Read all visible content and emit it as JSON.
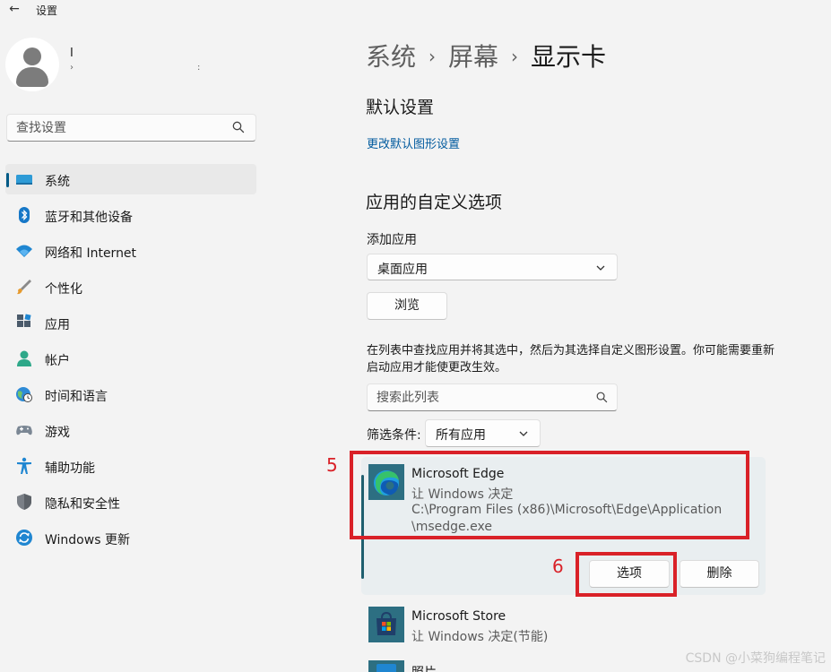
{
  "window": {
    "title": "设置",
    "back_icon": "back-arrow-icon"
  },
  "user": {
    "name": "I",
    "email": "›",
    "email_tail": ":"
  },
  "sidebar": {
    "search_placeholder": "查找设置",
    "items": [
      {
        "label": "系统",
        "icon": "monitor-icon",
        "active": true
      },
      {
        "label": "蓝牙和其他设备",
        "icon": "bluetooth-icon"
      },
      {
        "label": "网络和 Internet",
        "icon": "wifi-icon"
      },
      {
        "label": "个性化",
        "icon": "brush-icon"
      },
      {
        "label": "应用",
        "icon": "apps-icon"
      },
      {
        "label": "帐户",
        "icon": "account-icon"
      },
      {
        "label": "时间和语言",
        "icon": "globe-clock-icon"
      },
      {
        "label": "游戏",
        "icon": "gamepad-icon"
      },
      {
        "label": "辅助功能",
        "icon": "accessibility-icon"
      },
      {
        "label": "隐私和安全性",
        "icon": "shield-icon"
      },
      {
        "label": "Windows 更新",
        "icon": "update-icon"
      }
    ]
  },
  "main": {
    "breadcrumb": [
      "系统",
      "屏幕",
      "显示卡"
    ],
    "default_section": {
      "title": "默认设置",
      "link": "更改默认图形设置"
    },
    "custom_section": {
      "title": "应用的自定义选项",
      "add_app_label": "添加应用",
      "app_type_value": "桌面应用",
      "browse_button": "浏览",
      "description": "在列表中查找应用并将其选中，然后为其选择自定义图形设置。你可能需要重新启动应用才能使更改生效。",
      "list_search_placeholder": "搜索此列表",
      "filter_label": "筛选条件:",
      "filter_value": "所有应用"
    },
    "apps": [
      {
        "name": "Microsoft Edge",
        "setting": "让 Windows 决定",
        "path_line1": "C:\\Program Files (x86)\\Microsoft\\Edge\\Application",
        "path_line2": "\\msedge.exe",
        "options_button": "选项",
        "remove_button": "删除",
        "selected": true
      },
      {
        "name": "Microsoft Store",
        "setting": "让 Windows 决定(节能)"
      },
      {
        "name": "照片"
      }
    ]
  },
  "annotations": {
    "box1_number": "5",
    "box2_number": "6",
    "color": "#d92128"
  },
  "watermark": "CSDN @小菜狗编程笔记",
  "colors": {
    "accent": "#005a86",
    "link": "#005a9e",
    "background": "#f3f3f3"
  }
}
